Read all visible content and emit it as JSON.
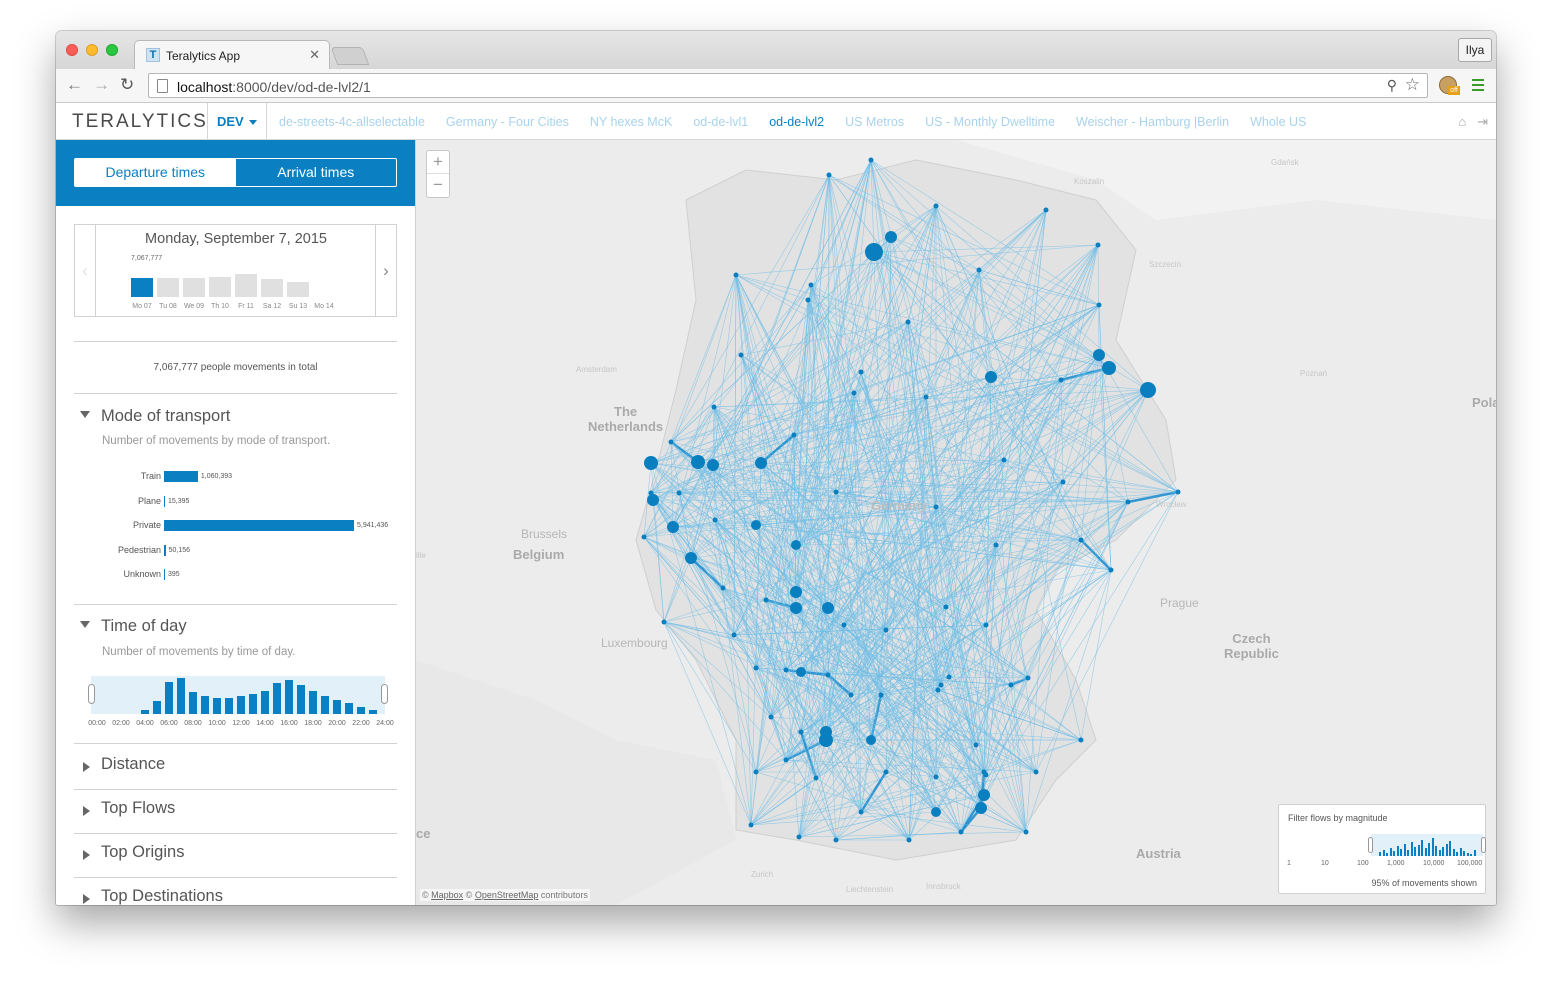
{
  "browser": {
    "tab_title": "Teralytics App",
    "tab_favicon": "T",
    "profile_name": "Ilya",
    "url_host": "localhost",
    "url_path": ":8000/dev/od-de-lvl2/1"
  },
  "nav": {
    "logo": "TERALYTICS",
    "env": "DEV",
    "links": [
      {
        "label": "de-streets-4c-allselectable",
        "active": false
      },
      {
        "label": "Germany - Four Cities",
        "active": false
      },
      {
        "label": "NY hexes McK",
        "active": false
      },
      {
        "label": "od-de-lvl1",
        "active": false
      },
      {
        "label": "od-de-lvl2",
        "active": true
      },
      {
        "label": "US Metros",
        "active": false
      },
      {
        "label": "US - Monthly Dwelltime",
        "active": false
      },
      {
        "label": "Weischer - Hamburg |Berlin",
        "active": false
      },
      {
        "label": "Whole US",
        "active": false
      }
    ],
    "icons": [
      "home-icon",
      "logout-icon"
    ]
  },
  "sidebar": {
    "toggle": {
      "departure": "Departure times",
      "arrival": "Arrival times",
      "selected": "departure"
    },
    "date": {
      "title": "Monday, September 7, 2015",
      "max_label": "7,067,777",
      "days": [
        {
          "label": "Mo 07",
          "level": 0.58,
          "selected": true
        },
        {
          "label": "Tu 08",
          "level": 0.58,
          "selected": false
        },
        {
          "label": "We 09",
          "level": 0.58,
          "selected": false
        },
        {
          "label": "Th 10",
          "level": 0.64,
          "selected": false
        },
        {
          "label": "Fr 11",
          "level": 0.72,
          "selected": false
        },
        {
          "label": "Sa 12",
          "level": 0.56,
          "selected": false
        },
        {
          "label": "Su 13",
          "level": 0.46,
          "selected": false
        },
        {
          "label": "Mo 14",
          "level": 0,
          "selected": false
        }
      ]
    },
    "total_text": "7,067,777 people movements in total",
    "mode": {
      "title": "Mode of transport",
      "subtitle": "Number of movements by mode of transport.",
      "rows": [
        {
          "label": "Train",
          "value": 1060393,
          "display": "1,060,393"
        },
        {
          "label": "Plane",
          "value": 15395,
          "display": "15,395"
        },
        {
          "label": "Private",
          "value": 5941436,
          "display": "5,941,436"
        },
        {
          "label": "Pedestrian",
          "value": 50156,
          "display": "50,156"
        },
        {
          "label": "Unknown",
          "value": 395,
          "display": "395"
        }
      ]
    },
    "time_of_day": {
      "title": "Time of day",
      "subtitle": "Number of movements by time of day.",
      "levels": [
        0,
        0,
        0,
        0,
        0.1,
        0.35,
        0.9,
        1.0,
        0.6,
        0.5,
        0.45,
        0.45,
        0.5,
        0.55,
        0.65,
        0.85,
        0.95,
        0.8,
        0.65,
        0.5,
        0.4,
        0.3,
        0.2,
        0.1
      ],
      "tick_labels": [
        "00:00",
        "02:00",
        "04:00",
        "06:00",
        "08:00",
        "10:00",
        "12:00",
        "14:00",
        "16:00",
        "18:00",
        "20:00",
        "22:00",
        "24:00"
      ]
    },
    "collapsed_sections": [
      "Distance",
      "Top Flows",
      "Top Origins",
      "Top Destinations"
    ]
  },
  "map": {
    "zoom_in": "+",
    "zoom_out": "−",
    "labels": {
      "gdansk": "Gdańsk",
      "koszalin": "Koszalin",
      "szczecin": "Szczecin",
      "poznan": "Poznań",
      "amsterdam": "Amsterdam",
      "the_netherlands": "The\nNetherlands",
      "brussels": "Brussels",
      "belgium": "Belgium",
      "luxembourg": "Luxembourg",
      "wroclaw": "Wrocław",
      "prague": "Prague",
      "czech_republic": "Czech\nRepublic",
      "polan": "Polan",
      "austria": "Austria",
      "zurich": "Zurich",
      "liechtenstein": "Liechtenstein",
      "innsbruck": "Innsbruck",
      "germany": "Germany",
      "ce": "ce",
      "ille": "ille"
    },
    "attribution_mapbox": "Mapbox",
    "attribution_osm": "OpenStreetMap",
    "attribution_suffix": " contributors",
    "filter": {
      "title": "Filter flows by magnitude",
      "ticks": [
        "1",
        "10",
        "100",
        "1,000",
        "10,000",
        "100,000"
      ],
      "percent_text": "95% of movements shown"
    },
    "colors": {
      "flow": "#6dbde6",
      "node": "#0a7fc0",
      "land": "#ececec"
    }
  }
}
